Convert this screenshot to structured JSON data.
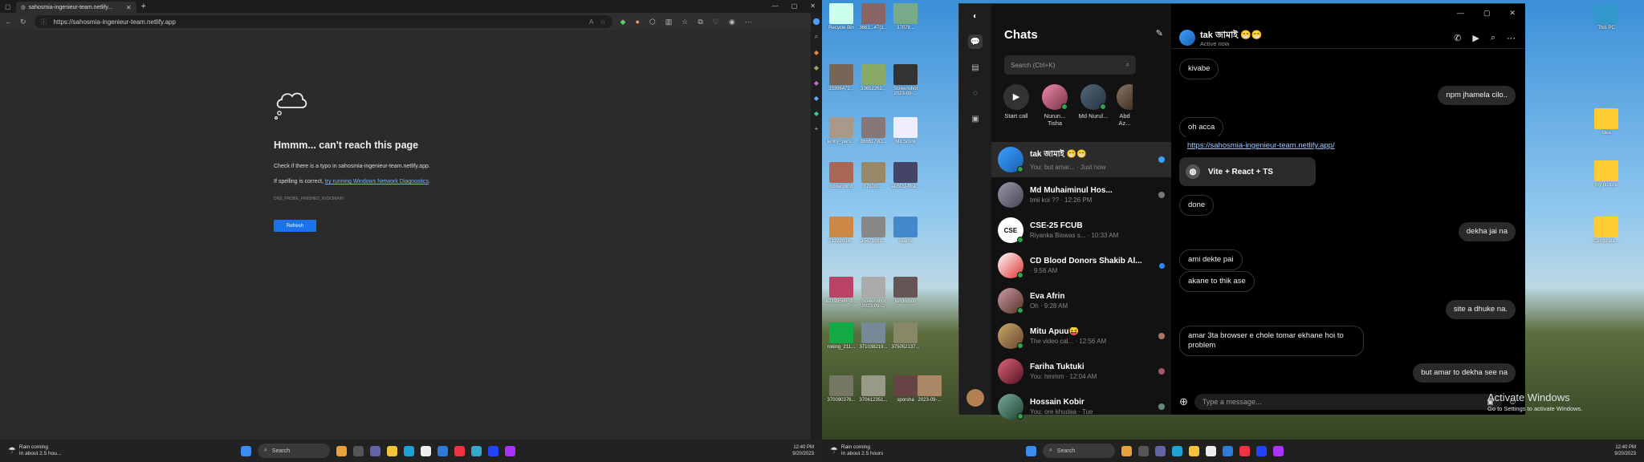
{
  "browser": {
    "tab_title": "sahosmia-ingenieur-team.netlify...",
    "url": "https://sahosmia-ingenieur-team.netlify.app",
    "error": {
      "title": "Hmmm... can't reach this page",
      "line1": "Check if there is a typo in sahosmia-ingenieur-team.netlify.app.",
      "line2_prefix": "If spelling is correct, ",
      "line2_link": "try running Windows Network Diagnostics",
      "line2_suffix": ".",
      "code": "DNS_PROBE_FINISHED_NXDOMAIN",
      "refresh_label": "Refresh"
    }
  },
  "taskbar_left": {
    "weather_title": "Rain coming",
    "weather_sub": "In about 2.5 hou...",
    "search_label": "Search",
    "time": "12:40 PM",
    "date": "9/20/2023"
  },
  "taskbar_right": {
    "weather_title": "Rain coming",
    "weather_sub": "In about 2.5 hours",
    "search_label": "Search",
    "time": "12:40 PM",
    "date": "9/20/2023"
  },
  "desktop": {
    "icons": [
      {
        "label": "Recycle Bin"
      },
      {
        "label": "3663...47(1..."
      },
      {
        "label": "37078..."
      },
      {
        "label": "33396472..."
      },
      {
        "label": "33652262..."
      },
      {
        "label": "Screenshot 2023-09-..."
      },
      {
        "label": "lenny_pers..."
      },
      {
        "label": "3666179D..."
      },
      {
        "label": "Mir.Score"
      },
      {
        "label": "codenbind"
      },
      {
        "label": "371031..."
      },
      {
        "label": "al-BOJ-ffira..."
      },
      {
        "label": "71222834..."
      },
      {
        "label": "35479289..."
      },
      {
        "label": "Teams"
      },
      {
        "label": "82199588_2..."
      },
      {
        "label": "Screenshot 2023-09-..."
      },
      {
        "label": "jundorbon"
      },
      {
        "label": "roking_211..."
      },
      {
        "label": "371038219..."
      },
      {
        "label": "375052137..."
      },
      {
        "label": "370090376..."
      },
      {
        "label": "370612351..."
      },
      {
        "label": "sporsha"
      },
      {
        "label": "This PC"
      },
      {
        "label": "idea"
      },
      {
        "label": "my picture"
      },
      {
        "label": "Certificate..."
      },
      {
        "label": "2023-09-..."
      }
    ]
  },
  "messenger": {
    "section_title": "Chats",
    "search_placeholder": "Search (Ctrl+K)",
    "stories": [
      {
        "label": "Start call"
      },
      {
        "label": "Nurun... Tisha"
      },
      {
        "label": "Md Nurul..."
      },
      {
        "label": "Abd Az..."
      }
    ],
    "chats": [
      {
        "name": "tak জামাই 😁😁",
        "preview": "You: but amar... · Just now"
      },
      {
        "name": "Md Muhaiminul Hos...",
        "preview": "tmii koi ?? · 12:26 PM"
      },
      {
        "name": "CSE-25 FCUB",
        "preview": "Riyanka Biswas s... · 10:33 AM"
      },
      {
        "name": "CD Blood Donors Shakib Al...",
        "preview": "· 9:56 AM"
      },
      {
        "name": "Eva Afrin",
        "preview": "Oh · 9:28 AM"
      },
      {
        "name": "Mitu Apuu😝",
        "preview": "The video cal... · 12:56 AM"
      },
      {
        "name": "Fariha Tuktuki",
        "preview": "You: hmmm · 12:04 AM"
      },
      {
        "name": "Hossain Kobir",
        "preview": "You: ore khudaa · Tue"
      }
    ],
    "conversation": {
      "name": "tak জামাই 😁😁",
      "status": "Active now",
      "messages": [
        {
          "dir": "in",
          "text": "kivabe"
        },
        {
          "dir": "out",
          "text": "npm jhamela cilo.."
        },
        {
          "dir": "in",
          "text": "oh acca"
        },
        {
          "dir": "in",
          "text": "https://sahosmia-ingenieur-team.netlify.app/"
        },
        {
          "dir": "in",
          "text": "done"
        },
        {
          "dir": "out",
          "text": "dekha jai na"
        },
        {
          "dir": "in",
          "text": "ami dekte pai"
        },
        {
          "dir": "in",
          "text": "akane to thik ase"
        },
        {
          "dir": "out",
          "text": "site   a dhuke na."
        },
        {
          "dir": "in",
          "text": "amar 3ta browser e chole tomar ekhane hoi to problem"
        },
        {
          "dir": "out",
          "text": "but amar to dekha see na"
        }
      ],
      "link_card": "Vite + React + TS",
      "input_placeholder": "Type a message..."
    }
  },
  "windows_watermark": {
    "title": "Activate Windows",
    "sub": "Go to Settings to activate Windows."
  }
}
